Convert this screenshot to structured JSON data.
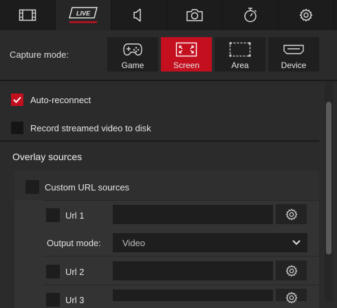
{
  "tabs": [
    {
      "name": "film-icon"
    },
    {
      "name": "live-icon",
      "label": "LIVE",
      "active": true
    },
    {
      "name": "speaker-icon"
    },
    {
      "name": "camera-icon"
    },
    {
      "name": "stopwatch-icon"
    },
    {
      "name": "gear-icon"
    }
  ],
  "capture": {
    "label": "Capture mode:",
    "modes": [
      {
        "label": "Game",
        "icon": "gamepad-icon"
      },
      {
        "label": "Screen",
        "icon": "screen-expand-icon",
        "active": true
      },
      {
        "label": "Area",
        "icon": "area-select-icon"
      },
      {
        "label": "Device",
        "icon": "hdmi-icon"
      }
    ]
  },
  "options": {
    "auto_reconnect": {
      "label": "Auto-reconnect",
      "checked": true
    },
    "record_to_disk": {
      "label": "Record streamed video to disk",
      "checked": false
    }
  },
  "overlay": {
    "title": "Overlay sources",
    "custom_url": {
      "label": "Custom URL sources",
      "checked": false
    },
    "urls": [
      {
        "label": "Url 1",
        "checked": false,
        "value": ""
      },
      {
        "label": "Url 2",
        "checked": false,
        "value": ""
      },
      {
        "label": "Url 3",
        "checked": false,
        "value": ""
      }
    ],
    "output_mode": {
      "label": "Output mode:",
      "value": "Video"
    }
  },
  "colors": {
    "accent": "#c40f1f",
    "background": "#2b2b2b",
    "topbar": "#1c1c1c"
  }
}
